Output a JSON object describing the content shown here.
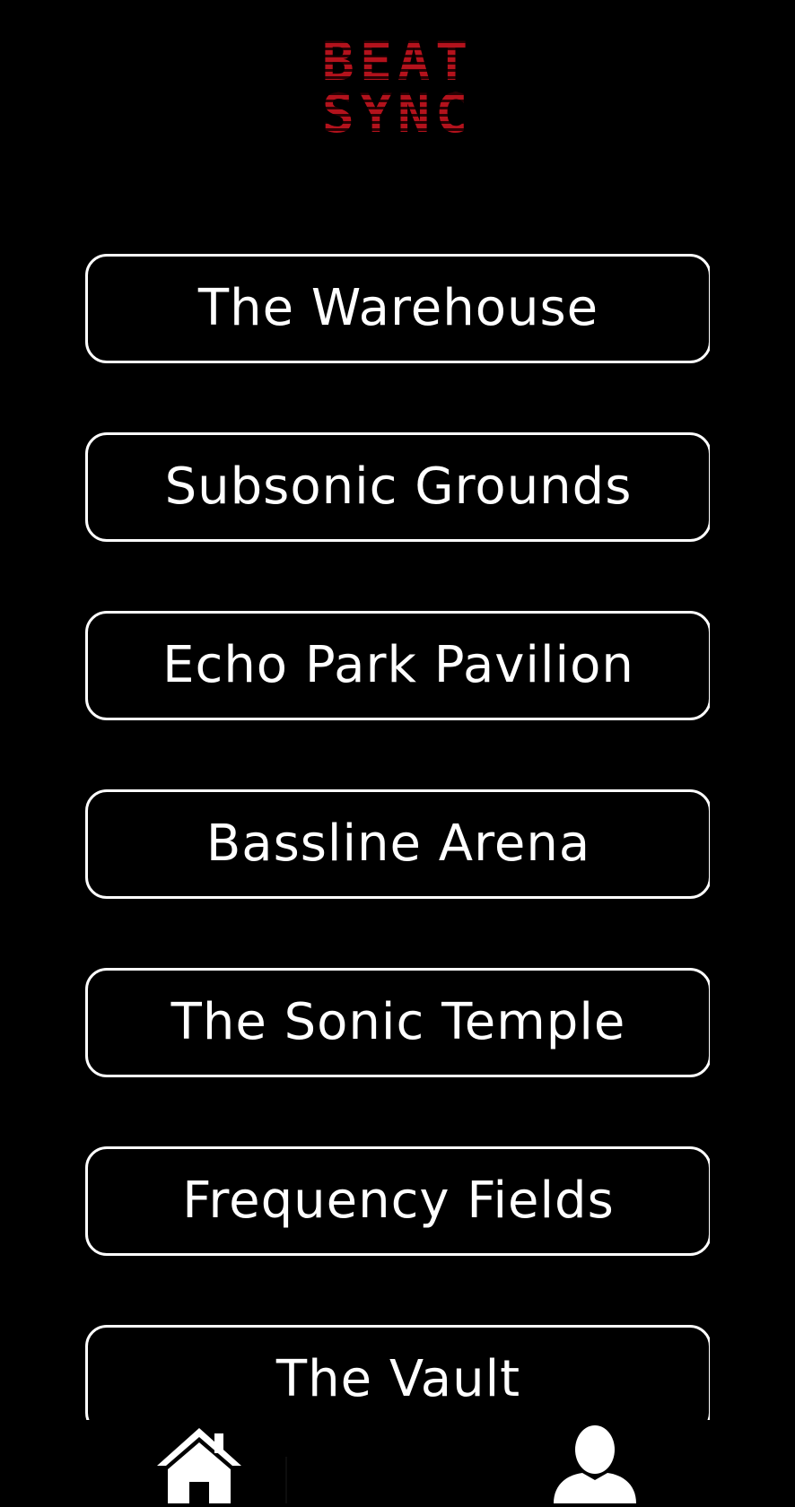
{
  "app": {
    "logo_line1": "BEAT",
    "logo_line2": "SYNC",
    "accent_color": "#b3121c"
  },
  "venues": [
    {
      "label": "The Warehouse"
    },
    {
      "label": "Subsonic Grounds"
    },
    {
      "label": "Echo Park Pavilion"
    },
    {
      "label": "Bassline Arena"
    },
    {
      "label": "The Sonic Temple"
    },
    {
      "label": "Frequency Fields"
    },
    {
      "label": "The Vault"
    }
  ],
  "nav": {
    "home_icon": "home-icon",
    "profile_icon": "user-icon"
  }
}
